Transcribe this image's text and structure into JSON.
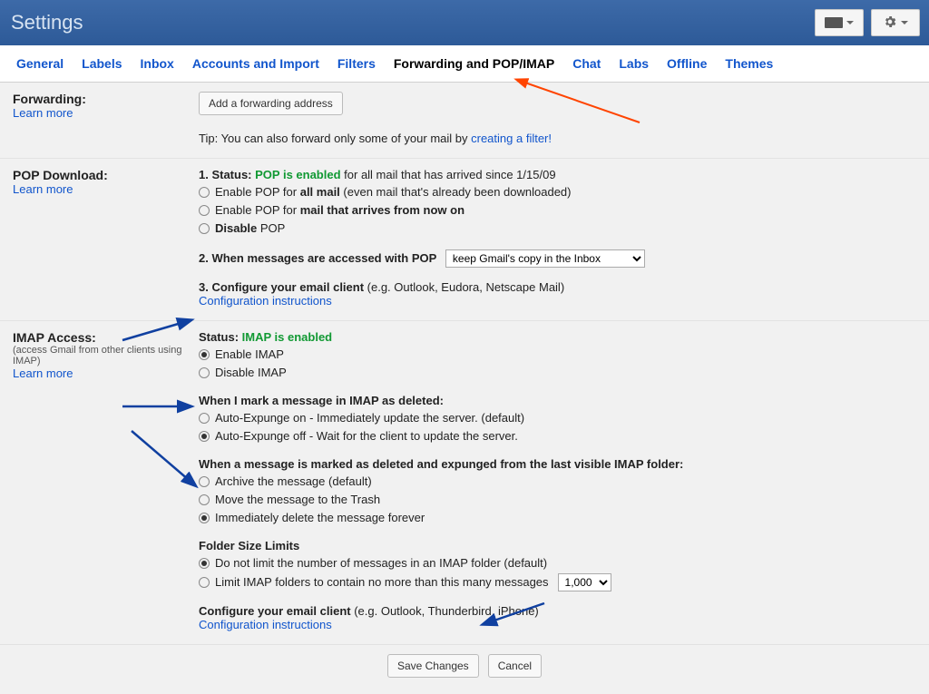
{
  "header": {
    "title": "Settings"
  },
  "tabs": [
    {
      "label": "General"
    },
    {
      "label": "Labels"
    },
    {
      "label": "Inbox"
    },
    {
      "label": "Accounts and Import"
    },
    {
      "label": "Filters"
    },
    {
      "label": "Forwarding and POP/IMAP"
    },
    {
      "label": "Chat"
    },
    {
      "label": "Labs"
    },
    {
      "label": "Offline"
    },
    {
      "label": "Themes"
    }
  ],
  "forwarding": {
    "title": "Forwarding:",
    "learn": "Learn more",
    "add_btn": "Add a forwarding address",
    "tip_prefix": "Tip: You can also forward only some of your mail by ",
    "tip_link": "creating a filter!"
  },
  "pop": {
    "title": "POP Download:",
    "learn": "Learn more",
    "status_num": "1. Status: ",
    "status_value": "POP is enabled",
    "status_suffix": " for all mail that has arrived since 1/15/09",
    "opt1_prefix": "Enable POP for ",
    "opt1_bold": "all mail",
    "opt1_suffix": " (even mail that's already been downloaded)",
    "opt2_prefix": "Enable POP for ",
    "opt2_bold": "mail that arrives from now on",
    "opt3_bold": "Disable",
    "opt3_suffix": " POP",
    "access_head": "2. When messages are accessed with POP",
    "access_select": "keep Gmail's copy in the Inbox",
    "configure_head": "3. Configure your email client",
    "configure_suffix": " (e.g. Outlook, Eudora, Netscape Mail)",
    "config_link": "Configuration instructions"
  },
  "imap": {
    "title": "IMAP Access:",
    "sub": "(access Gmail from other clients using IMAP)",
    "learn": "Learn more",
    "status_label": "Status: ",
    "status_value": "IMAP is enabled",
    "enable": "Enable IMAP",
    "disable": "Disable IMAP",
    "delete_head": "When I mark a message in IMAP as deleted:",
    "del_opt1": "Auto-Expunge on - Immediately update the server. (default)",
    "del_opt2": "Auto-Expunge off - Wait for the client to update the server.",
    "expunge_head": "When a message is marked as deleted and expunged from the last visible IMAP folder:",
    "exp_opt1": "Archive the message (default)",
    "exp_opt2": "Move the message to the Trash",
    "exp_opt3": "Immediately delete the message forever",
    "folder_head": "Folder Size Limits",
    "fold_opt1": "Do not limit the number of messages in an IMAP folder (default)",
    "fold_opt2": "Limit IMAP folders to contain no more than this many messages",
    "fold_select": "1,000",
    "configure_head": "Configure your email client",
    "configure_suffix": " (e.g. Outlook, Thunderbird, iPhone)",
    "config_link": "Configuration instructions"
  },
  "actions": {
    "save": "Save Changes",
    "cancel": "Cancel"
  }
}
